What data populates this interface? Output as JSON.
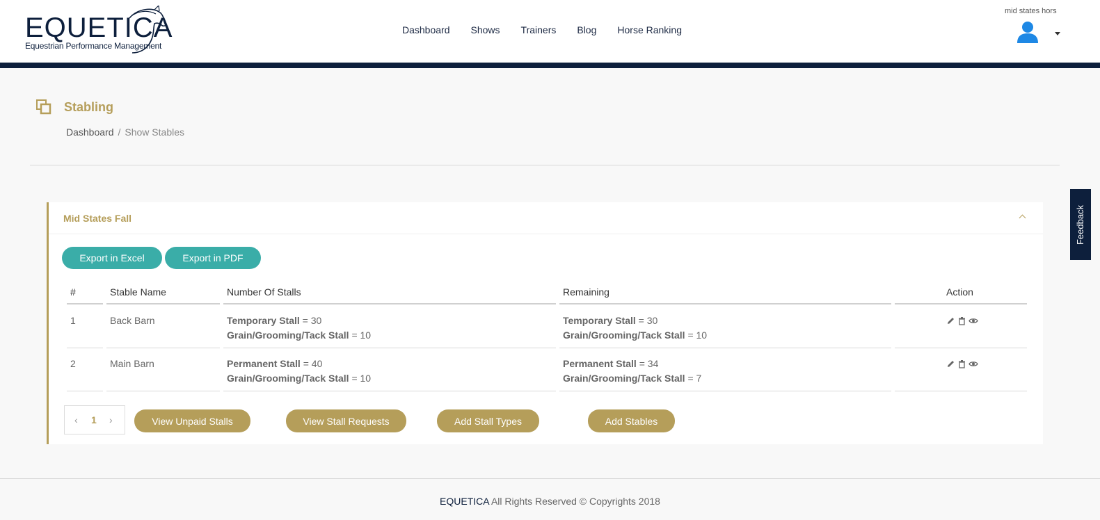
{
  "header": {
    "logo_word": "EQUETICA",
    "logo_tagline": "Equestrian Performance Management",
    "nav": [
      "Dashboard",
      "Shows",
      "Trainers",
      "Blog",
      "Horse Ranking"
    ],
    "user_name": "mid states hors"
  },
  "page": {
    "title": "Stabling",
    "breadcrumb": [
      "Dashboard",
      "Show Stables"
    ]
  },
  "feedback_label": "Feedback",
  "card": {
    "title": "Mid States Fall",
    "export_excel": "Export in Excel",
    "export_pdf": "Export in PDF",
    "columns": [
      "#",
      "Stable Name",
      "Number Of Stalls",
      "Remaining",
      "Action"
    ],
    "rows": [
      {
        "num": "1",
        "name": "Back Barn",
        "stalls": [
          {
            "label": "Temporary Stall",
            "value": "= 30"
          },
          {
            "label": "Grain/Grooming/Tack Stall",
            "value": "= 10"
          }
        ],
        "remaining": [
          {
            "label": "Temporary Stall",
            "value": "= 30"
          },
          {
            "label": "Grain/Grooming/Tack Stall",
            "value": "= 10"
          }
        ]
      },
      {
        "num": "2",
        "name": "Main Barn",
        "stalls": [
          {
            "label": "Permanent Stall",
            "value": "= 40"
          },
          {
            "label": "Grain/Grooming/Tack Stall",
            "value": "= 10"
          }
        ],
        "remaining": [
          {
            "label": "Permanent Stall",
            "value": "= 34"
          },
          {
            "label": "Grain/Grooming/Tack Stall",
            "value": "= 7"
          }
        ]
      }
    ],
    "pager": {
      "prev": "‹",
      "page": "1",
      "next": "›"
    },
    "buttons": {
      "unpaid": "View Unpaid Stalls",
      "requests": "View Stall Requests",
      "types": "Add Stall Types",
      "stables": "Add Stables"
    }
  },
  "footer": {
    "brand": "EQUETICA",
    "text": " All Rights Reserved © Copyrights 2018"
  },
  "colors": {
    "navy": "#0d1f3c",
    "gold": "#b59e5a",
    "teal": "#3aada8"
  }
}
